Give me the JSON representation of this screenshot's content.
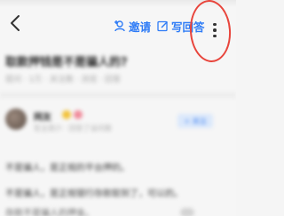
{
  "topbar": {
    "invite_label": "邀请",
    "answer_label": "写回答"
  },
  "question": {
    "title": "取款押钱是不是骗人的?",
    "meta": "提问 · 1万 · 关注数 · 浏览 · 回答"
  },
  "answer": {
    "author_name": "网友",
    "author_desc": "答主简介 · 回答了该问题",
    "follow_label": "+ 关注",
    "paragraphs": [
      "不是骗人，是正规的平台押的。",
      "不是骗人，是正规银行存款取到了，可以的。",
      "存款不是骗人的押金。"
    ]
  },
  "colors": {
    "accent": "#2f7cf6",
    "annotation_ring": "#e8453c"
  },
  "icons": {
    "back": "chevron-left-icon",
    "invite": "add-user-icon",
    "answer": "edit-icon",
    "more": "more-vertical-icon"
  }
}
